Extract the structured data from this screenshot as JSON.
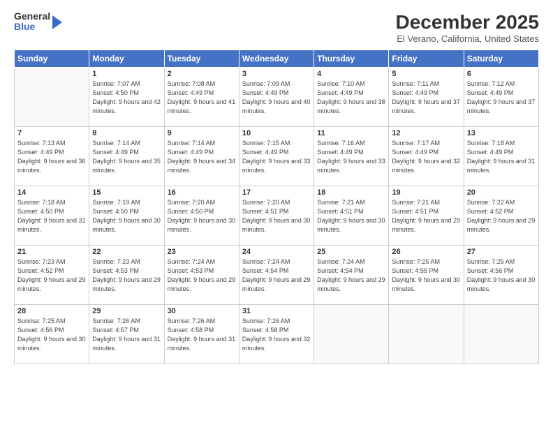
{
  "logo": {
    "general": "General",
    "blue": "Blue"
  },
  "title": "December 2025",
  "location": "El Verano, California, United States",
  "weekdays": [
    "Sunday",
    "Monday",
    "Tuesday",
    "Wednesday",
    "Thursday",
    "Friday",
    "Saturday"
  ],
  "weeks": [
    [
      {
        "day": "",
        "sunrise": "",
        "sunset": "",
        "daylight": ""
      },
      {
        "day": "1",
        "sunrise": "Sunrise: 7:07 AM",
        "sunset": "Sunset: 4:50 PM",
        "daylight": "Daylight: 9 hours and 42 minutes."
      },
      {
        "day": "2",
        "sunrise": "Sunrise: 7:08 AM",
        "sunset": "Sunset: 4:49 PM",
        "daylight": "Daylight: 9 hours and 41 minutes."
      },
      {
        "day": "3",
        "sunrise": "Sunrise: 7:09 AM",
        "sunset": "Sunset: 4:49 PM",
        "daylight": "Daylight: 9 hours and 40 minutes."
      },
      {
        "day": "4",
        "sunrise": "Sunrise: 7:10 AM",
        "sunset": "Sunset: 4:49 PM",
        "daylight": "Daylight: 9 hours and 38 minutes."
      },
      {
        "day": "5",
        "sunrise": "Sunrise: 7:11 AM",
        "sunset": "Sunset: 4:49 PM",
        "daylight": "Daylight: 9 hours and 37 minutes."
      },
      {
        "day": "6",
        "sunrise": "Sunrise: 7:12 AM",
        "sunset": "Sunset: 4:49 PM",
        "daylight": "Daylight: 9 hours and 37 minutes."
      }
    ],
    [
      {
        "day": "7",
        "sunrise": "Sunrise: 7:13 AM",
        "sunset": "Sunset: 4:49 PM",
        "daylight": "Daylight: 9 hours and 36 minutes."
      },
      {
        "day": "8",
        "sunrise": "Sunrise: 7:14 AM",
        "sunset": "Sunset: 4:49 PM",
        "daylight": "Daylight: 9 hours and 35 minutes."
      },
      {
        "day": "9",
        "sunrise": "Sunrise: 7:14 AM",
        "sunset": "Sunset: 4:49 PM",
        "daylight": "Daylight: 9 hours and 34 minutes."
      },
      {
        "day": "10",
        "sunrise": "Sunrise: 7:15 AM",
        "sunset": "Sunset: 4:49 PM",
        "daylight": "Daylight: 9 hours and 33 minutes."
      },
      {
        "day": "11",
        "sunrise": "Sunrise: 7:16 AM",
        "sunset": "Sunset: 4:49 PM",
        "daylight": "Daylight: 9 hours and 33 minutes."
      },
      {
        "day": "12",
        "sunrise": "Sunrise: 7:17 AM",
        "sunset": "Sunset: 4:49 PM",
        "daylight": "Daylight: 9 hours and 32 minutes."
      },
      {
        "day": "13",
        "sunrise": "Sunrise: 7:18 AM",
        "sunset": "Sunset: 4:49 PM",
        "daylight": "Daylight: 9 hours and 31 minutes."
      }
    ],
    [
      {
        "day": "14",
        "sunrise": "Sunrise: 7:18 AM",
        "sunset": "Sunset: 4:50 PM",
        "daylight": "Daylight: 9 hours and 31 minutes."
      },
      {
        "day": "15",
        "sunrise": "Sunrise: 7:19 AM",
        "sunset": "Sunset: 4:50 PM",
        "daylight": "Daylight: 9 hours and 30 minutes."
      },
      {
        "day": "16",
        "sunrise": "Sunrise: 7:20 AM",
        "sunset": "Sunset: 4:50 PM",
        "daylight": "Daylight: 9 hours and 30 minutes."
      },
      {
        "day": "17",
        "sunrise": "Sunrise: 7:20 AM",
        "sunset": "Sunset: 4:51 PM",
        "daylight": "Daylight: 9 hours and 30 minutes."
      },
      {
        "day": "18",
        "sunrise": "Sunrise: 7:21 AM",
        "sunset": "Sunset: 4:51 PM",
        "daylight": "Daylight: 9 hours and 30 minutes."
      },
      {
        "day": "19",
        "sunrise": "Sunrise: 7:21 AM",
        "sunset": "Sunset: 4:51 PM",
        "daylight": "Daylight: 9 hours and 29 minutes."
      },
      {
        "day": "20",
        "sunrise": "Sunrise: 7:22 AM",
        "sunset": "Sunset: 4:52 PM",
        "daylight": "Daylight: 9 hours and 29 minutes."
      }
    ],
    [
      {
        "day": "21",
        "sunrise": "Sunrise: 7:23 AM",
        "sunset": "Sunset: 4:52 PM",
        "daylight": "Daylight: 9 hours and 29 minutes."
      },
      {
        "day": "22",
        "sunrise": "Sunrise: 7:23 AM",
        "sunset": "Sunset: 4:53 PM",
        "daylight": "Daylight: 9 hours and 29 minutes."
      },
      {
        "day": "23",
        "sunrise": "Sunrise: 7:24 AM",
        "sunset": "Sunset: 4:53 PM",
        "daylight": "Daylight: 9 hours and 29 minutes."
      },
      {
        "day": "24",
        "sunrise": "Sunrise: 7:24 AM",
        "sunset": "Sunset: 4:54 PM",
        "daylight": "Daylight: 9 hours and 29 minutes."
      },
      {
        "day": "25",
        "sunrise": "Sunrise: 7:24 AM",
        "sunset": "Sunset: 4:54 PM",
        "daylight": "Daylight: 9 hours and 29 minutes."
      },
      {
        "day": "26",
        "sunrise": "Sunrise: 7:25 AM",
        "sunset": "Sunset: 4:55 PM",
        "daylight": "Daylight: 9 hours and 30 minutes."
      },
      {
        "day": "27",
        "sunrise": "Sunrise: 7:25 AM",
        "sunset": "Sunset: 4:56 PM",
        "daylight": "Daylight: 9 hours and 30 minutes."
      }
    ],
    [
      {
        "day": "28",
        "sunrise": "Sunrise: 7:25 AM",
        "sunset": "Sunset: 4:56 PM",
        "daylight": "Daylight: 9 hours and 30 minutes."
      },
      {
        "day": "29",
        "sunrise": "Sunrise: 7:26 AM",
        "sunset": "Sunset: 4:57 PM",
        "daylight": "Daylight: 9 hours and 31 minutes."
      },
      {
        "day": "30",
        "sunrise": "Sunrise: 7:26 AM",
        "sunset": "Sunset: 4:58 PM",
        "daylight": "Daylight: 9 hours and 31 minutes."
      },
      {
        "day": "31",
        "sunrise": "Sunrise: 7:26 AM",
        "sunset": "Sunset: 4:58 PM",
        "daylight": "Daylight: 9 hours and 32 minutes."
      },
      {
        "day": "",
        "sunrise": "",
        "sunset": "",
        "daylight": ""
      },
      {
        "day": "",
        "sunrise": "",
        "sunset": "",
        "daylight": ""
      },
      {
        "day": "",
        "sunrise": "",
        "sunset": "",
        "daylight": ""
      }
    ]
  ]
}
